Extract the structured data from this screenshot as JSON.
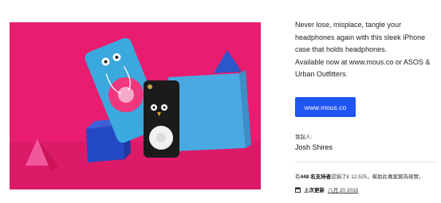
{
  "hero_image": {
    "background_color": "#e81d6f"
  },
  "description": {
    "lines": [
      "Never lose, misplace, tangle your",
      "headphones again with this sleek iPhone",
      "case that holds headphones.",
      "Available now at www.mous.co or ASOS &",
      "Urban Outfitters."
    ]
  },
  "cta": {
    "label": "www.mous.co",
    "color": "#1f55f3"
  },
  "owner": {
    "label": "發起人:",
    "name": "Josh Shires"
  },
  "backers": {
    "prefix": "有",
    "count_text": "448 名支持者",
    "suffix": "認捐了£ 12,525，幫助此專案變為現實。"
  },
  "updated": {
    "label": "上次更新",
    "date": "八月 20 2015",
    "icon": "calendar-icon"
  }
}
